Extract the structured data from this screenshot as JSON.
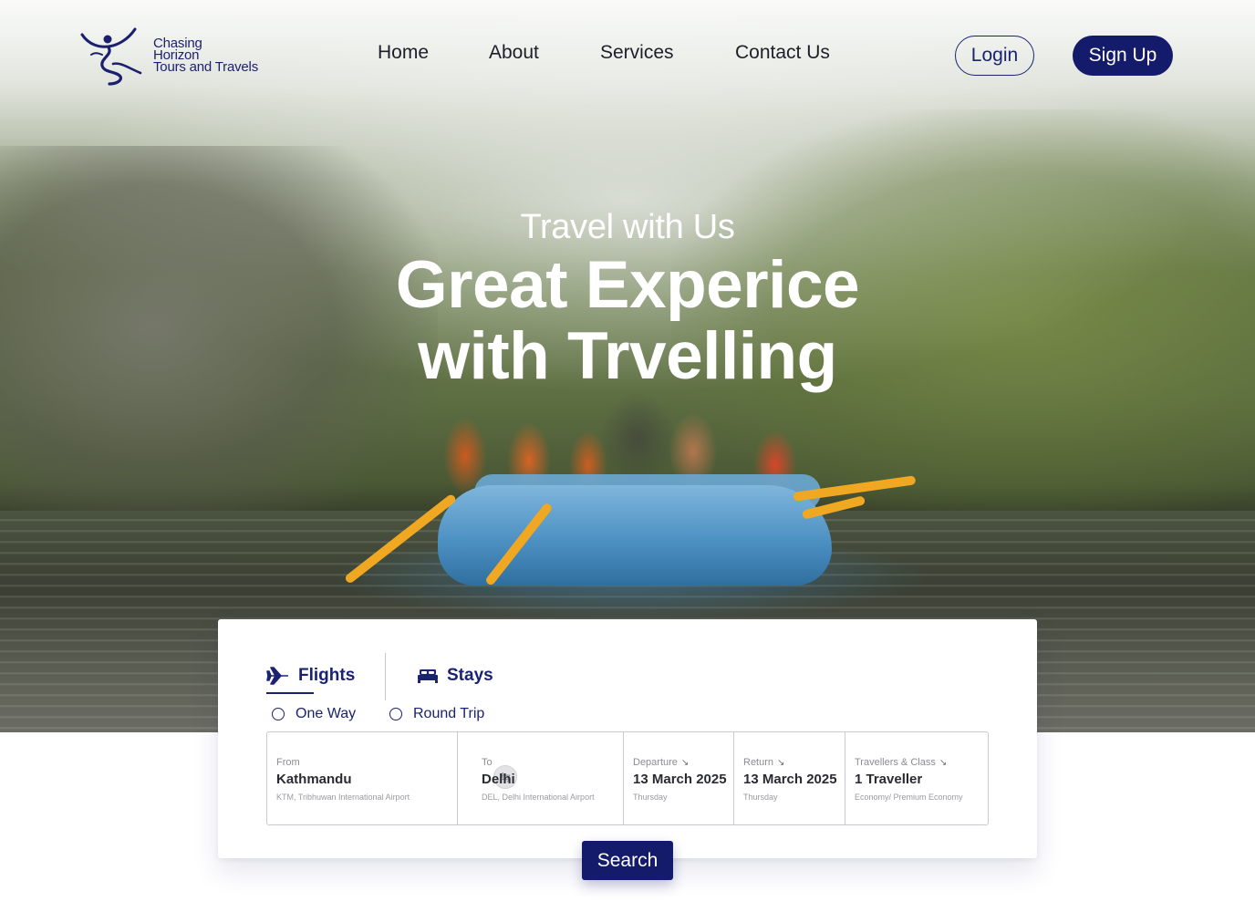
{
  "brand": {
    "name_line1": "Chasing",
    "name_line2": "Horizon",
    "name_line3": "Tours and Travels",
    "logo_icon": "dancing-figure-logo",
    "color": "#1b1f6e"
  },
  "nav": {
    "items": [
      {
        "label": "Home"
      },
      {
        "label": "About"
      },
      {
        "label": "Services"
      },
      {
        "label": "Contact Us"
      }
    ],
    "login_label": "Login",
    "signup_label": "Sign Up"
  },
  "hero": {
    "subtitle": "Travel with Us",
    "headline_line1": "Great Experice",
    "headline_line2": "with Trvelling"
  },
  "search": {
    "tabs": [
      {
        "label": "Flights",
        "icon": "airplane-icon",
        "active": true
      },
      {
        "label": "Stays",
        "icon": "bed-icon",
        "active": false
      }
    ],
    "trip_types": [
      {
        "label": "One Way",
        "selected": false
      },
      {
        "label": "Round Trip",
        "selected": false
      }
    ],
    "from": {
      "label": "From",
      "value": "Kathmandu",
      "sub": "KTM, Tribhuwan International Airport"
    },
    "to": {
      "label": "To",
      "value": "Delhi",
      "sub": "DEL, Delhi International Airport"
    },
    "departure": {
      "label": "Departure",
      "value": "13 March 2025",
      "sub": "Thursday"
    },
    "return": {
      "label": "Return",
      "value": "13 March 2025",
      "sub": "Thursday"
    },
    "travellers": {
      "label": "Travellers & Class",
      "value": "1 Traveller",
      "sub": "Economy/ Premium Economy"
    },
    "swap_icon": "swap-arrows-icon",
    "search_label": "Search"
  },
  "colors": {
    "primary": "#141b6a",
    "paddle": "#f0a722"
  }
}
